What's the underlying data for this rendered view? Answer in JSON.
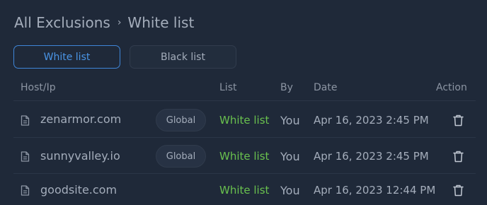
{
  "breadcrumb": {
    "root": "All Exclusions",
    "separator": "›",
    "current": "White list"
  },
  "tabs": [
    {
      "label": "White list",
      "active": true
    },
    {
      "label": "Black list",
      "active": false
    }
  ],
  "table": {
    "columns": {
      "host": "Host/Ip",
      "list": "List",
      "by": "By",
      "date": "Date",
      "action": "Action"
    },
    "rows": [
      {
        "host": "zenarmor.com",
        "scope": "Global",
        "list": "White list",
        "by": "You",
        "date": "Apr 16, 2023 2:45 PM"
      },
      {
        "host": "sunnyvalley.io",
        "scope": "Global",
        "list": "White list",
        "by": "You",
        "date": "Apr 16, 2023 2:45 PM"
      },
      {
        "host": "goodsite.com",
        "scope": null,
        "list": "White list",
        "by": "You",
        "date": "Apr 16, 2023 12:44 PM"
      }
    ]
  },
  "icons": {
    "row_icon": "document-icon",
    "action_icon": "trash-icon"
  },
  "colors": {
    "background": "#1f2939",
    "accent": "#4a95e6",
    "list_green": "#69c14e",
    "text": "#a4adbb"
  }
}
